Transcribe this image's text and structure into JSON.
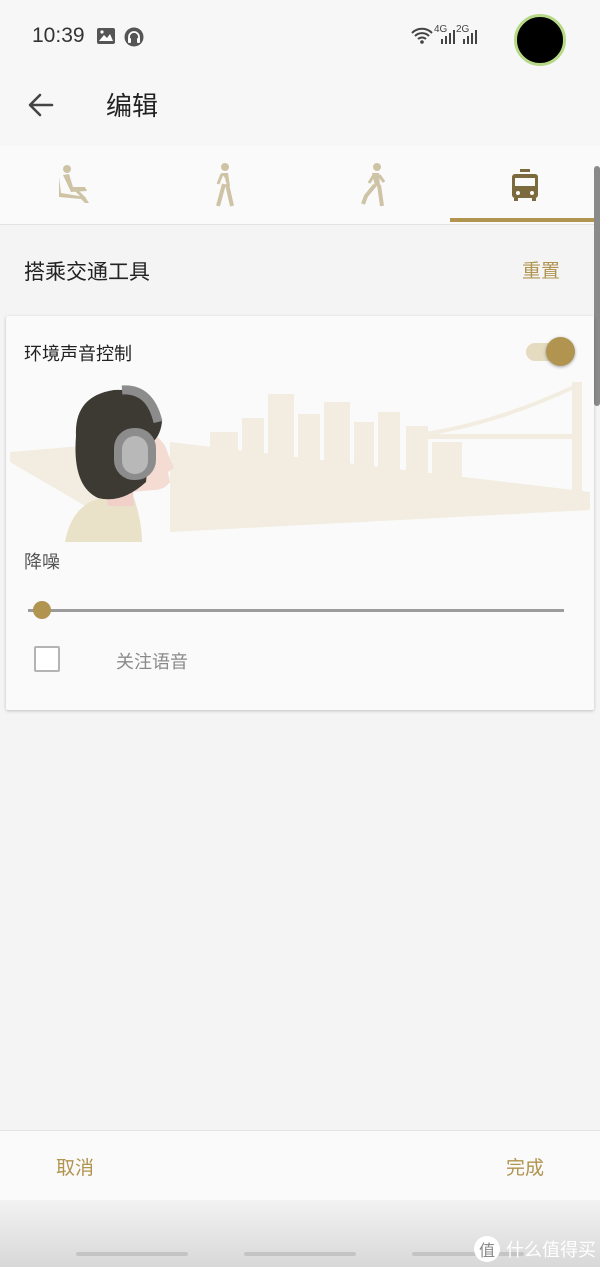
{
  "status_bar": {
    "time": "10:39",
    "network_1": "4G",
    "network_2": "2G"
  },
  "app_bar": {
    "title": "编辑"
  },
  "tabs": [
    {
      "name": "sitting",
      "icon": "sitting-person-icon"
    },
    {
      "name": "walking",
      "icon": "walking-person-icon"
    },
    {
      "name": "running",
      "icon": "running-person-icon"
    },
    {
      "name": "transport",
      "icon": "train-icon",
      "selected": true
    }
  ],
  "section": {
    "title": "搭乘交通工具",
    "reset_label": "重置"
  },
  "card": {
    "title": "环境声音控制",
    "toggle_on": true,
    "slider_label": "降噪",
    "slider_value": 0.0,
    "checkbox_label": "关注语音",
    "checkbox_checked": false
  },
  "bottom_bar": {
    "cancel_label": "取消",
    "done_label": "完成"
  },
  "watermark": {
    "text": "什么值得买",
    "icon_text": "值"
  },
  "colors": {
    "accent": "#b09450",
    "background": "#f4f4f4",
    "card": "#fafafa"
  }
}
